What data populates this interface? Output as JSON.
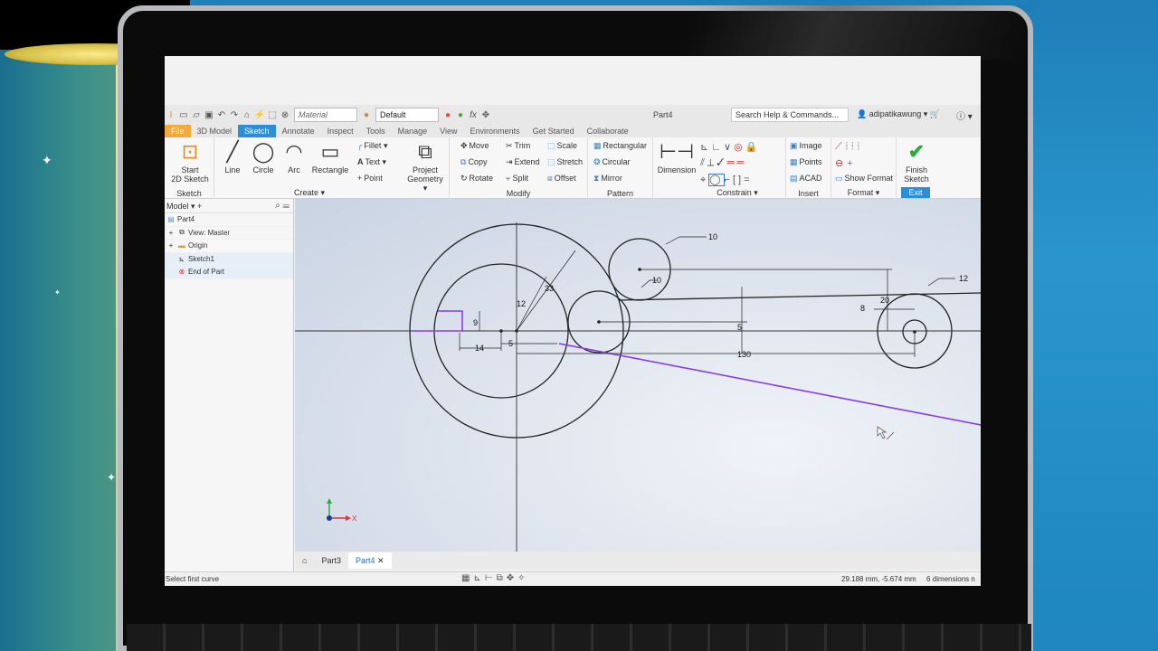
{
  "colors": {
    "accent": "#2a8fd8",
    "file_tab": "#f4a93c",
    "projected_line": "#8a3ce6",
    "sketch_line": "#222222"
  },
  "qat": {
    "material_placeholder": "Material",
    "appearance_value": "Default",
    "title": "Part4",
    "search_placeholder": "Search Help & Commands...",
    "user": "adipatikawung"
  },
  "tabs": [
    "File",
    "3D Model",
    "Sketch",
    "Annotate",
    "Inspect",
    "Tools",
    "Manage",
    "View",
    "Environments",
    "Get Started",
    "Collaborate"
  ],
  "ribbon": {
    "sketch": {
      "start_line1": "Start",
      "start_line2": "2D Sketch",
      "title": "Sketch"
    },
    "create": {
      "line": "Line",
      "circle": "Circle",
      "arc": "Arc",
      "rectangle": "Rectangle",
      "fillet": "Fillet",
      "text": "Text",
      "point": "Point",
      "project_line1": "Project",
      "project_line2": "Geometry",
      "title": "Create"
    },
    "modify": {
      "move": "Move",
      "copy": "Copy",
      "rotate": "Rotate",
      "trim": "Trim",
      "extend": "Extend",
      "split": "Split",
      "scale": "Scale",
      "stretch": "Stretch",
      "offset": "Offset",
      "title": "Modify"
    },
    "pattern": {
      "rectangular": "Rectangular",
      "circular": "Circular",
      "mirror": "Mirror",
      "title": "Pattern"
    },
    "constrain": {
      "dimension": "Dimension",
      "title": "Constrain"
    },
    "insert": {
      "image": "Image",
      "points": "Points",
      "acad": "ACAD",
      "title": "Insert"
    },
    "format": {
      "show_format": "Show Format",
      "title": "Format"
    },
    "exit": {
      "finish_line1": "Finish",
      "finish_line2": "Sketch",
      "title": "Exit"
    }
  },
  "browser": {
    "header": "Model",
    "items": [
      "Part4",
      "View: Master",
      "Origin",
      "Sketch1",
      "End of Part"
    ]
  },
  "dimensions": {
    "d10_top": "10",
    "d10_small": "10",
    "d12_right": "12",
    "d12_center": "12",
    "d33": "33",
    "d20": "20",
    "d8": "8",
    "d9": "9",
    "d14": "14",
    "d5_left": "5",
    "d5_mid": "5",
    "d130": "130",
    "axis_x": "X"
  },
  "doctabs": [
    "Part3",
    "Part4"
  ],
  "status": {
    "message": "Select first curve",
    "coordinates": "29.188 mm, -5.674 mm",
    "dimension_count": "6 dimensions n"
  }
}
